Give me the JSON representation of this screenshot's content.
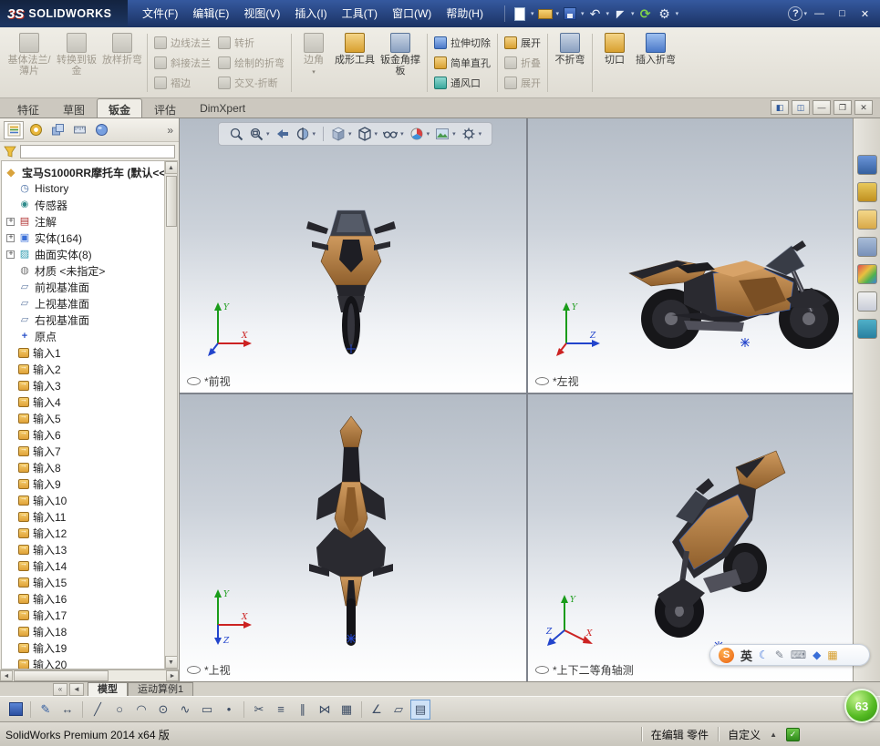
{
  "titlebar": {
    "logo_mark": "3S",
    "logo_text": "SOLIDWORKS",
    "menus": [
      {
        "label": "文件(F)"
      },
      {
        "label": "编辑(E)"
      },
      {
        "label": "视图(V)"
      },
      {
        "label": "插入(I)"
      },
      {
        "label": "工具(T)"
      },
      {
        "label": "窗口(W)"
      },
      {
        "label": "帮助(H)"
      }
    ]
  },
  "glyphs": {
    "caret_down": "▾",
    "undo": "↶",
    "select": "◤",
    "rebuild": "⟳",
    "options": "⚙",
    "help": "?",
    "win_min": "—",
    "win_max": "□",
    "win_close": "✕",
    "doc_min": "—",
    "doc_restore": "❐",
    "doc_close": "✕",
    "pane_left": "◧",
    "pane_grid": "◫",
    "chevrons_right": "»",
    "scroll_up": "▲",
    "scroll_down": "▼",
    "scroll_left": "◄",
    "scroll_right": "►",
    "tab_first": "«",
    "status_caret": "▲",
    "check": "✓"
  },
  "ribbon": {
    "base_flange": "基体法兰/薄片",
    "convert": "转换到钣金",
    "lofted_bend": "放样折弯",
    "edge_flange": "边线法兰",
    "miter_flange": "斜接法兰",
    "hem": "褶边",
    "jog": "转折",
    "sketched_bend": "绘制的折弯",
    "cross_break": "交叉-折断",
    "corner": "边角",
    "forming_tool": "成形工具",
    "gusset": "钣金角撑板",
    "extruded_cut": "拉伸切除",
    "simple_hole": "简单直孔",
    "vent": "通风口",
    "unfold": "展开",
    "fold": "折叠",
    "flatten": "展开",
    "no_bends": "不折弯",
    "rip": "切口",
    "insert_bends": "插入折弯"
  },
  "command_tabs": [
    {
      "label": "特征",
      "state": ""
    },
    {
      "label": "草图",
      "state": ""
    },
    {
      "label": "钣金",
      "state": "active"
    },
    {
      "label": "评估",
      "state": ""
    },
    {
      "label": "DimXpert",
      "state": ""
    }
  ],
  "feature_tree": {
    "root": "宝马S1000RR摩托车 (默认<<",
    "items": [
      {
        "label": "History",
        "icon": "history",
        "expand": false
      },
      {
        "label": "传感器",
        "icon": "sensors",
        "expand": false
      },
      {
        "label": "注解",
        "icon": "annotations",
        "expand": true
      },
      {
        "label": "实体(164)",
        "icon": "solid",
        "expand": true
      },
      {
        "label": "曲面实体(8)",
        "icon": "surface",
        "expand": true
      },
      {
        "label": "材质 <未指定>",
        "icon": "material",
        "expand": false
      },
      {
        "label": "前视基准面",
        "icon": "plane",
        "expand": false
      },
      {
        "label": "上视基准面",
        "icon": "plane",
        "expand": false
      },
      {
        "label": "右视基准面",
        "icon": "plane",
        "expand": false
      },
      {
        "label": "原点",
        "icon": "origin",
        "expand": false
      }
    ],
    "imports": [
      "输入1",
      "输入2",
      "输入3",
      "输入4",
      "输入5",
      "输入6",
      "输入7",
      "输入8",
      "输入9",
      "输入10",
      "输入11",
      "输入12",
      "输入13",
      "输入14",
      "输入15",
      "输入16",
      "输入17",
      "输入18",
      "输入19",
      "输入20"
    ]
  },
  "viewports": [
    {
      "label": "*前视",
      "axes": {
        "up": "Y",
        "right": "X"
      }
    },
    {
      "label": "*左视",
      "axes": {
        "up": "Y",
        "right": "Z"
      }
    },
    {
      "label": "*上视",
      "axes": {
        "up": "Y",
        "right": "X",
        "down": "Z"
      }
    },
    {
      "label": "*上下二等角轴测",
      "axes": {
        "up": "Y",
        "right": "X",
        "left": "Z"
      }
    }
  ],
  "hud_icons": [
    "zoom-to-fit",
    "zoom-to-area",
    "previous-view",
    "section-view",
    "view-orientation",
    "display-style",
    "hide-show-items",
    "edit-appearance",
    "apply-scene",
    "view-settings"
  ],
  "taskpane": {
    "icons": [
      {
        "name": "resources-icon",
        "style": "tp1"
      },
      {
        "name": "design-library-icon",
        "style": "tp2"
      },
      {
        "name": "file-explorer-icon",
        "style": "tp3"
      },
      {
        "name": "view-palette-icon",
        "style": "tp4"
      },
      {
        "name": "appearances-icon",
        "style": "tp5"
      },
      {
        "name": "custom-properties-icon",
        "style": "tp6"
      },
      {
        "name": "forum-icon",
        "style": "tp7"
      }
    ]
  },
  "bottom_tabs": {
    "tabs": [
      {
        "label": "模型",
        "state": "active"
      },
      {
        "label": "运动算例1",
        "state": ""
      }
    ]
  },
  "bottom_toolbar": {
    "icons": [
      {
        "name": "save-icon",
        "style": "disk",
        "glyph": ""
      },
      {
        "name": "separator",
        "style": "sep",
        "glyph": ""
      },
      {
        "name": "sketch-icon",
        "style": "pen",
        "glyph": "✎"
      },
      {
        "name": "smart-dimension-icon",
        "style": "",
        "glyph": "↔"
      },
      {
        "name": "separator",
        "style": "sep",
        "glyph": ""
      },
      {
        "name": "line-icon",
        "style": "",
        "glyph": "╱"
      },
      {
        "name": "circle-icon",
        "style": "",
        "glyph": "○"
      },
      {
        "name": "arc-icon",
        "style": "",
        "glyph": "◠"
      },
      {
        "name": "ellipse-icon",
        "style": "",
        "glyph": "⊙"
      },
      {
        "name": "spline-icon",
        "style": "",
        "glyph": "∿"
      },
      {
        "name": "rectangle-icon",
        "style": "",
        "glyph": "▭"
      },
      {
        "name": "point-icon",
        "style": "",
        "glyph": "•"
      },
      {
        "name": "separator",
        "style": "sep",
        "glyph": ""
      },
      {
        "name": "trim-icon",
        "style": "",
        "glyph": "✂"
      },
      {
        "name": "convert-entities-icon",
        "style": "",
        "glyph": "≡"
      },
      {
        "name": "offset-icon",
        "style": "",
        "glyph": "∥"
      },
      {
        "name": "mirror-icon",
        "style": "",
        "glyph": "⋈"
      },
      {
        "name": "linear-pattern-icon",
        "style": "",
        "glyph": "▦"
      },
      {
        "name": "separator",
        "style": "sep",
        "glyph": ""
      },
      {
        "name": "angle-icon",
        "style": "",
        "glyph": "∠"
      },
      {
        "name": "plane-icon",
        "style": "",
        "glyph": "▱"
      },
      {
        "name": "grid-icon",
        "style": "active",
        "glyph": "▤"
      }
    ]
  },
  "statusbar": {
    "left": "SolidWorks Premium 2014 x64 版",
    "editing": "在编辑 零件",
    "custom": "自定义"
  },
  "sogou": {
    "logo": "S",
    "mode": "英",
    "icons": [
      {
        "name": "moon-icon",
        "glyph": "☾",
        "style": "blue"
      },
      {
        "name": "pencil-icon",
        "glyph": "✎",
        "style": "gray"
      },
      {
        "name": "keyboard-icon",
        "glyph": "⌨",
        "style": "gray"
      },
      {
        "name": "skin-icon",
        "glyph": "◆",
        "style": "blue"
      },
      {
        "name": "toolbox-icon",
        "glyph": "▦",
        "style": "gold"
      }
    ]
  },
  "assistant_ball": {
    "value": "63"
  }
}
